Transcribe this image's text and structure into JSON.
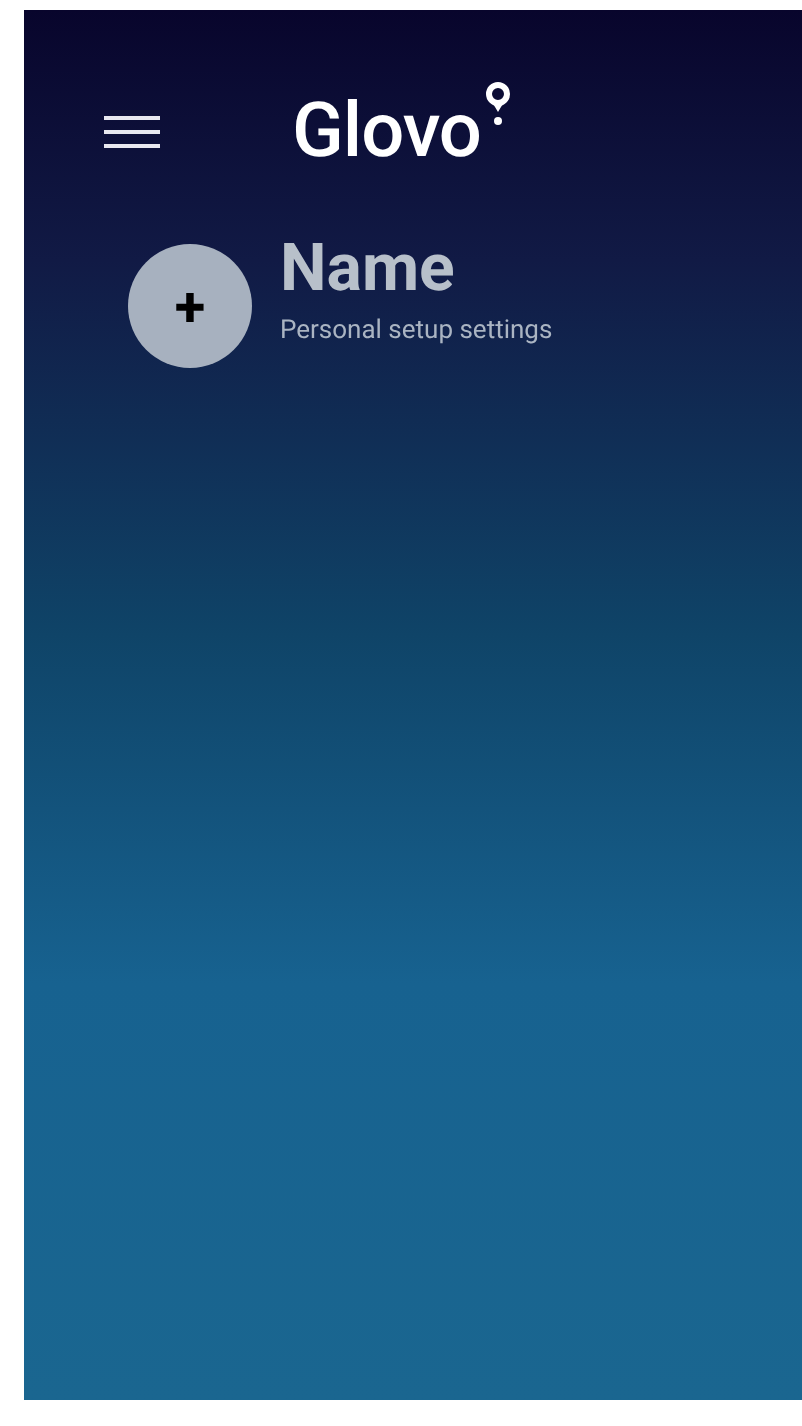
{
  "header": {
    "logo": "Glovo"
  },
  "profile": {
    "add_symbol": "+",
    "name": "Name",
    "subtitle": "Personal setup settings"
  }
}
